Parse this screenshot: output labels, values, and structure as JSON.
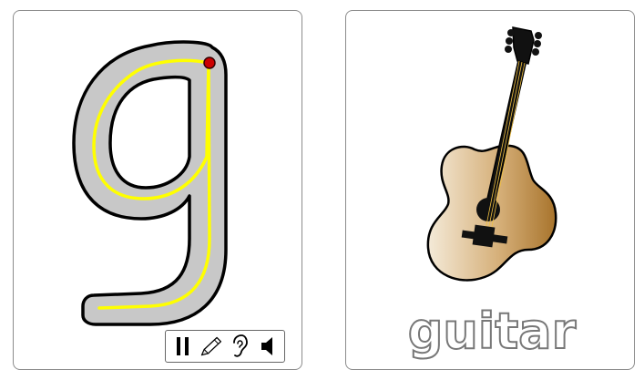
{
  "letter_card": {
    "letter": "g",
    "toolbar": {
      "pause_icon": "pause-icon",
      "pencil_icon": "pencil-icon",
      "ear_icon": "ear-icon",
      "speaker_icon": "speaker-icon"
    }
  },
  "picture_card": {
    "image_icon": "guitar-icon",
    "word": "guitar"
  },
  "colors": {
    "letter_fill": "#c8c8c8",
    "trace_line": "#ffff00",
    "start_dot": "#cc0000",
    "guitar_body_light": "#f4ead8",
    "guitar_body_dark": "#a8742c"
  }
}
